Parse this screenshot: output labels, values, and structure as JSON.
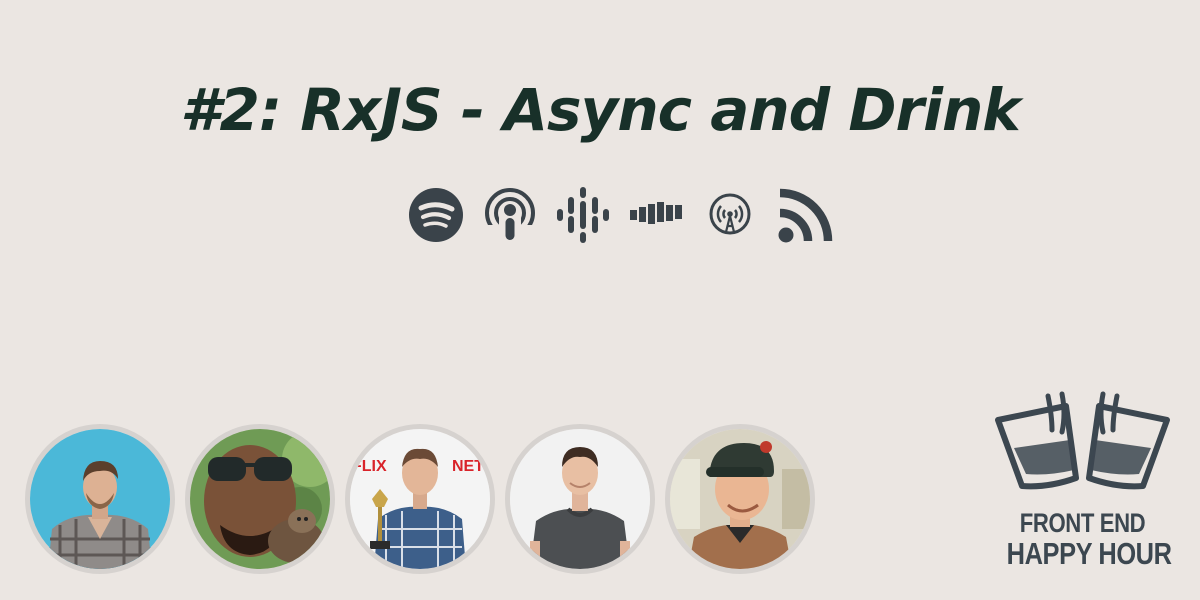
{
  "episode": {
    "title": "#2: RxJS - Async and Drink"
  },
  "platforms": [
    {
      "name": "spotify",
      "icon": "spotify-icon"
    },
    {
      "name": "apple-podcasts",
      "icon": "apple-podcasts-icon"
    },
    {
      "name": "google-podcasts",
      "icon": "google-podcasts-icon"
    },
    {
      "name": "castbox",
      "icon": "castbox-icon"
    },
    {
      "name": "overcast",
      "icon": "overcast-icon"
    },
    {
      "name": "rss",
      "icon": "rss-icon"
    }
  ],
  "panelists": [
    {
      "avatar": "panelist-1"
    },
    {
      "avatar": "panelist-2"
    },
    {
      "avatar": "panelist-3"
    },
    {
      "avatar": "panelist-4"
    },
    {
      "avatar": "panelist-5"
    }
  ],
  "logo": {
    "line1": "FRONT END",
    "line2": "HAPPY HOUR"
  },
  "colors": {
    "background": "#ebe6e2",
    "title": "#183029",
    "icons": "#3a434a",
    "avatar_border": "#d6d2cf",
    "logo": "#3c4750"
  }
}
